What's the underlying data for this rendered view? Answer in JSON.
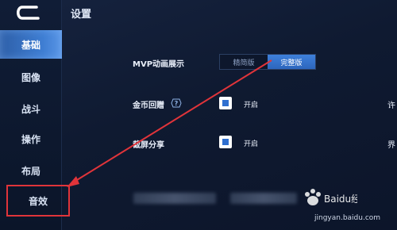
{
  "header": {
    "title": "设置"
  },
  "sidebar": {
    "items": [
      {
        "label": "基础"
      },
      {
        "label": "图像"
      },
      {
        "label": "战斗"
      },
      {
        "label": "操作"
      },
      {
        "label": "布局"
      },
      {
        "label": "音效"
      }
    ]
  },
  "settings": {
    "mvp": {
      "label": "MVP动画展示",
      "options": [
        "精简版",
        "完整版"
      ],
      "selected": "完整版"
    },
    "coin_gift": {
      "label": "金币回赠",
      "value_label": "开启",
      "checked": true
    },
    "screenshot_share": {
      "label": "截屏分享",
      "value_label": "开启",
      "checked": true
    },
    "cut_right_1": "许",
    "cut_right_2": "界"
  },
  "watermark": {
    "logo_text": "Baidu经验",
    "url": "jingyan.baidu.com"
  },
  "colors": {
    "accent": "#3f80db",
    "highlight_red": "#e0343a",
    "background": "#0f1a31"
  }
}
